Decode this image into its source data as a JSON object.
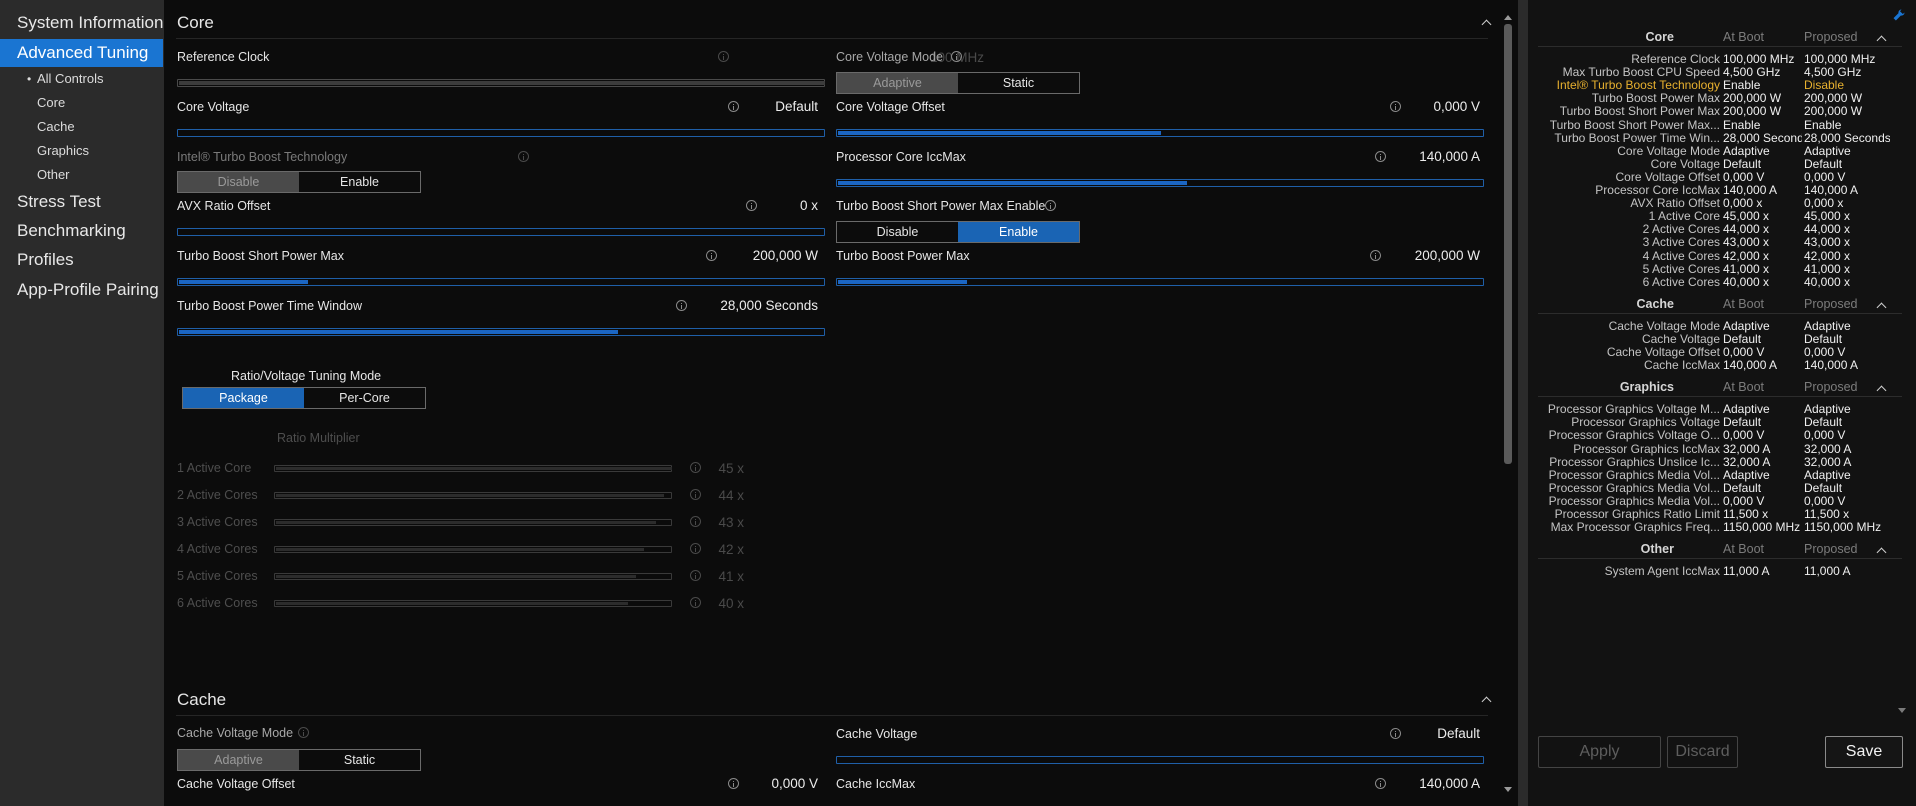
{
  "sidebar": {
    "items": [
      {
        "label": "System Information"
      },
      {
        "label": "Advanced Tuning"
      },
      {
        "label": "Stress Test"
      },
      {
        "label": "Benchmarking"
      },
      {
        "label": "Profiles"
      },
      {
        "label": "App-Profile Pairing"
      }
    ],
    "sub_items": [
      {
        "label": "All Controls"
      },
      {
        "label": "Core"
      },
      {
        "label": "Cache"
      },
      {
        "label": "Graphics"
      },
      {
        "label": "Other"
      }
    ],
    "bullet": "•"
  },
  "colors": {
    "accent": "#1a75d2",
    "slider_fill": "#1b66c4",
    "highlight": "#e8b12f",
    "background": "#0c0c0c"
  },
  "main": {
    "core": {
      "title": "Core",
      "reference_clock": {
        "label": "Reference Clock",
        "value": "100 MHz"
      },
      "core_voltage_mode": {
        "label": "Core Voltage Mode",
        "options": [
          "Adaptive",
          "Static"
        ],
        "selected": "Adaptive"
      },
      "core_voltage": {
        "label": "Core Voltage",
        "value": "Default",
        "fill": 0
      },
      "core_voltage_offset": {
        "label": "Core Voltage Offset",
        "value": "0,000 V",
        "fill": 0.5
      },
      "turbo_boost_tech": {
        "label": "Intel® Turbo Boost Technology",
        "options": [
          "Disable",
          "Enable"
        ],
        "selected": "Disable"
      },
      "processor_core_iccmax": {
        "label": "Processor Core IccMax",
        "value": "140,000 A",
        "fill": 0.54
      },
      "avx_ratio_offset": {
        "label": "AVX Ratio Offset",
        "value": "0 x",
        "fill": 0
      },
      "turbo_short_power_max_enable": {
        "label": "Turbo Boost Short Power Max Enable",
        "options": [
          "Disable",
          "Enable"
        ],
        "selected": "Enable"
      },
      "turbo_short_power_max": {
        "label": "Turbo Boost Short Power Max",
        "value": "200,000 W",
        "fill": 0.2
      },
      "turbo_power_max": {
        "label": "Turbo Boost Power Max",
        "value": "200,000 W",
        "fill": 0.2
      },
      "turbo_power_time_window": {
        "label": "Turbo Boost Power Time Window",
        "value": "28,000 Seconds",
        "fill": 0.68
      },
      "tuning_mode": {
        "label": "Ratio/Voltage Tuning Mode",
        "options": [
          "Package",
          "Per-Core"
        ],
        "selected": "Package"
      },
      "ratio_multiplier": {
        "label": "Ratio Multiplier",
        "rows": [
          {
            "label": "1 Active Core",
            "value": "45 x",
            "fill": 1.0
          },
          {
            "label": "2 Active Cores",
            "value": "44 x",
            "fill": 0.98
          },
          {
            "label": "3 Active Cores",
            "value": "43 x",
            "fill": 0.96
          },
          {
            "label": "4 Active Cores",
            "value": "42 x",
            "fill": 0.93
          },
          {
            "label": "5 Active Cores",
            "value": "41 x",
            "fill": 0.91
          },
          {
            "label": "6 Active Cores",
            "value": "40 x",
            "fill": 0.89
          }
        ]
      }
    },
    "cache": {
      "title": "Cache",
      "cache_voltage_mode": {
        "label": "Cache Voltage Mode",
        "options": [
          "Adaptive",
          "Static"
        ],
        "selected": "Adaptive"
      },
      "cache_voltage": {
        "label": "Cache Voltage",
        "value": "Default",
        "fill": 0
      },
      "cache_voltage_offset": {
        "label": "Cache Voltage Offset",
        "value": "0,000 V"
      },
      "cache_iccmax": {
        "label": "Cache IccMax",
        "value": "140,000 A"
      }
    }
  },
  "summary": {
    "col_boot": "At Boot",
    "col_proposed": "Proposed",
    "sections": [
      {
        "title": "Core",
        "rows": [
          {
            "name": "Reference Clock",
            "boot": "100,000 MHz",
            "proposed": "100,000 MHz"
          },
          {
            "name": "Max Turbo Boost CPU Speed",
            "boot": "4,500 GHz",
            "proposed": "4,500 GHz"
          },
          {
            "name": "Intel® Turbo Boost Technology",
            "boot": "Enable",
            "proposed": "Disable",
            "highlight": true
          },
          {
            "name": "Turbo Boost Power Max",
            "boot": "200,000 W",
            "proposed": "200,000 W"
          },
          {
            "name": "Turbo Boost Short Power Max",
            "boot": "200,000 W",
            "proposed": "200,000 W"
          },
          {
            "name": "Turbo Boost Short Power Max...",
            "boot": "Enable",
            "proposed": "Enable"
          },
          {
            "name": "Turbo Boost Power Time Win...",
            "boot": "28,000 Seconds",
            "proposed": "28,000 Seconds"
          },
          {
            "name": "Core Voltage Mode",
            "boot": "Adaptive",
            "proposed": "Adaptive"
          },
          {
            "name": "Core Voltage",
            "boot": "Default",
            "proposed": "Default"
          },
          {
            "name": "Core Voltage Offset",
            "boot": "0,000 V",
            "proposed": "0,000 V"
          },
          {
            "name": "Processor Core IccMax",
            "boot": "140,000 A",
            "proposed": "140,000 A"
          },
          {
            "name": "AVX Ratio Offset",
            "boot": "0,000 x",
            "proposed": "0,000 x"
          },
          {
            "name": "1 Active Core",
            "boot": "45,000 x",
            "proposed": "45,000 x"
          },
          {
            "name": "2 Active Cores",
            "boot": "44,000 x",
            "proposed": "44,000 x"
          },
          {
            "name": "3 Active Cores",
            "boot": "43,000 x",
            "proposed": "43,000 x"
          },
          {
            "name": "4 Active Cores",
            "boot": "42,000 x",
            "proposed": "42,000 x"
          },
          {
            "name": "5 Active Cores",
            "boot": "41,000 x",
            "proposed": "41,000 x"
          },
          {
            "name": "6 Active Cores",
            "boot": "40,000 x",
            "proposed": "40,000 x"
          }
        ]
      },
      {
        "title": "Cache",
        "rows": [
          {
            "name": "Cache Voltage Mode",
            "boot": "Adaptive",
            "proposed": "Adaptive"
          },
          {
            "name": "Cache Voltage",
            "boot": "Default",
            "proposed": "Default"
          },
          {
            "name": "Cache Voltage Offset",
            "boot": "0,000 V",
            "proposed": "0,000 V"
          },
          {
            "name": "Cache IccMax",
            "boot": "140,000 A",
            "proposed": "140,000 A"
          }
        ]
      },
      {
        "title": "Graphics",
        "rows": [
          {
            "name": "Processor Graphics Voltage M...",
            "boot": "Adaptive",
            "proposed": "Adaptive"
          },
          {
            "name": "Processor Graphics Voltage",
            "boot": "Default",
            "proposed": "Default"
          },
          {
            "name": "Processor Graphics Voltage O...",
            "boot": "0,000 V",
            "proposed": "0,000 V"
          },
          {
            "name": "Processor Graphics IccMax",
            "boot": "32,000 A",
            "proposed": "32,000 A"
          },
          {
            "name": "Processor Graphics Unslice Ic...",
            "boot": "32,000 A",
            "proposed": "32,000 A"
          },
          {
            "name": "Processor Graphics Media Vol...",
            "boot": "Adaptive",
            "proposed": "Adaptive"
          },
          {
            "name": "Processor Graphics Media Vol...",
            "boot": "Default",
            "proposed": "Default"
          },
          {
            "name": "Processor Graphics Media Vol...",
            "boot": "0,000 V",
            "proposed": "0,000 V"
          },
          {
            "name": "Processor Graphics Ratio Limit",
            "boot": "11,500 x",
            "proposed": "11,500 x"
          },
          {
            "name": "Max Processor Graphics Freq...",
            "boot": "1150,000 MHz",
            "proposed": "1150,000 MHz"
          }
        ]
      },
      {
        "title": "Other",
        "rows": [
          {
            "name": "System Agent IccMax",
            "boot": "11,000 A",
            "proposed": "11,000 A"
          }
        ]
      }
    ],
    "buttons": {
      "apply": "Apply",
      "discard": "Discard",
      "save": "Save"
    }
  }
}
